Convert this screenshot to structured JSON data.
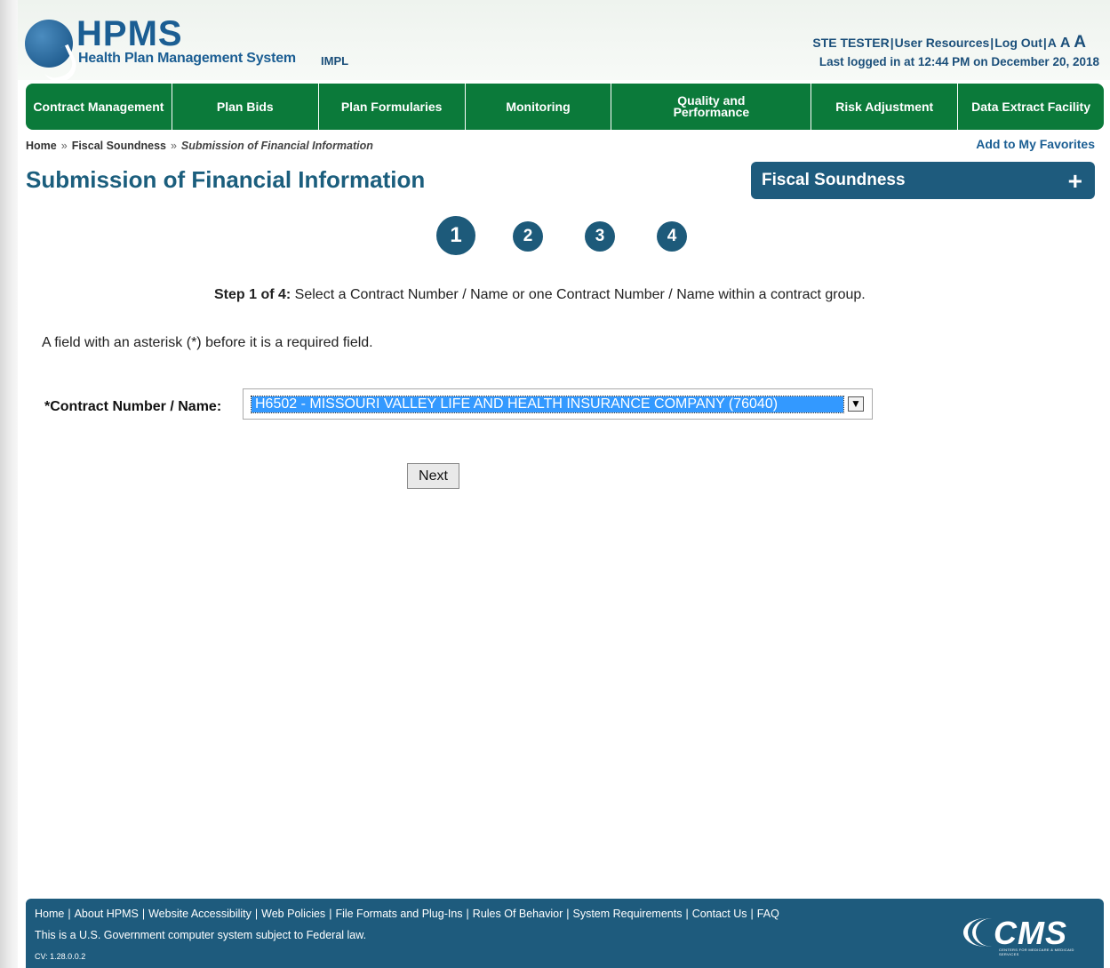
{
  "header": {
    "logo_title": "HPMS",
    "logo_subtitle": "Health Plan Management System",
    "environment": "IMPL",
    "user": "STE TESTER",
    "user_resources": "User Resources",
    "log_out": "Log Out",
    "font_size_small": "A",
    "font_size_medium": "A",
    "font_size_large": "A",
    "last_logged": "Last logged in at 12:44 PM on December 20, 2018"
  },
  "nav": {
    "items": [
      {
        "label": "Contract Management"
      },
      {
        "label": "Plan Bids"
      },
      {
        "label": "Plan Formularies"
      },
      {
        "label": "Monitoring"
      },
      {
        "label": "Quality and Performance"
      },
      {
        "label": "Risk Adjustment"
      },
      {
        "label": "Data Extract Facility"
      }
    ]
  },
  "breadcrumb": {
    "home": "Home",
    "separator": "»",
    "section": "Fiscal Soundness",
    "current": "Submission of Financial Information"
  },
  "add_favorites": "Add to My Favorites",
  "page_title": "Submission of Financial Information",
  "side_menu": {
    "label": "Fiscal Soundness",
    "icon": "plus-icon",
    "expand_symbol": "+"
  },
  "steps": [
    "1",
    "2",
    "3",
    "4"
  ],
  "instruction": {
    "bold": "Step 1 of 4:",
    "text": " Select a Contract Number / Name or one Contract Number / Name within a contract group."
  },
  "required_note": "A field with an asterisk (*) before it is a required field.",
  "form": {
    "contract_label": "*Contract Number / Name:",
    "contract_value": "H6502 - MISSOURI VALLEY LIFE AND HEALTH INSURANCE COMPANY (76040)",
    "next_label": "Next"
  },
  "footer": {
    "links": [
      "Home",
      "About HPMS",
      "Website Accessibility",
      "Web Policies",
      "File Formats and Plug-Ins",
      "Rules Of Behavior",
      "System Requirements",
      "Contact Us",
      "FAQ"
    ],
    "link_separator": "|",
    "notice": "This is a U.S. Government computer system subject to Federal law.",
    "version": "CV: 1.28.0.0.2",
    "cms_logo_text": "CMS",
    "cms_logo_tagline": "CENTERS FOR MEDICARE & MEDICAID SERVICES"
  },
  "colors": {
    "nav_green": "#0b7a3a",
    "brand_blue": "#1e5b7d",
    "selection_blue": "#3399ff"
  }
}
